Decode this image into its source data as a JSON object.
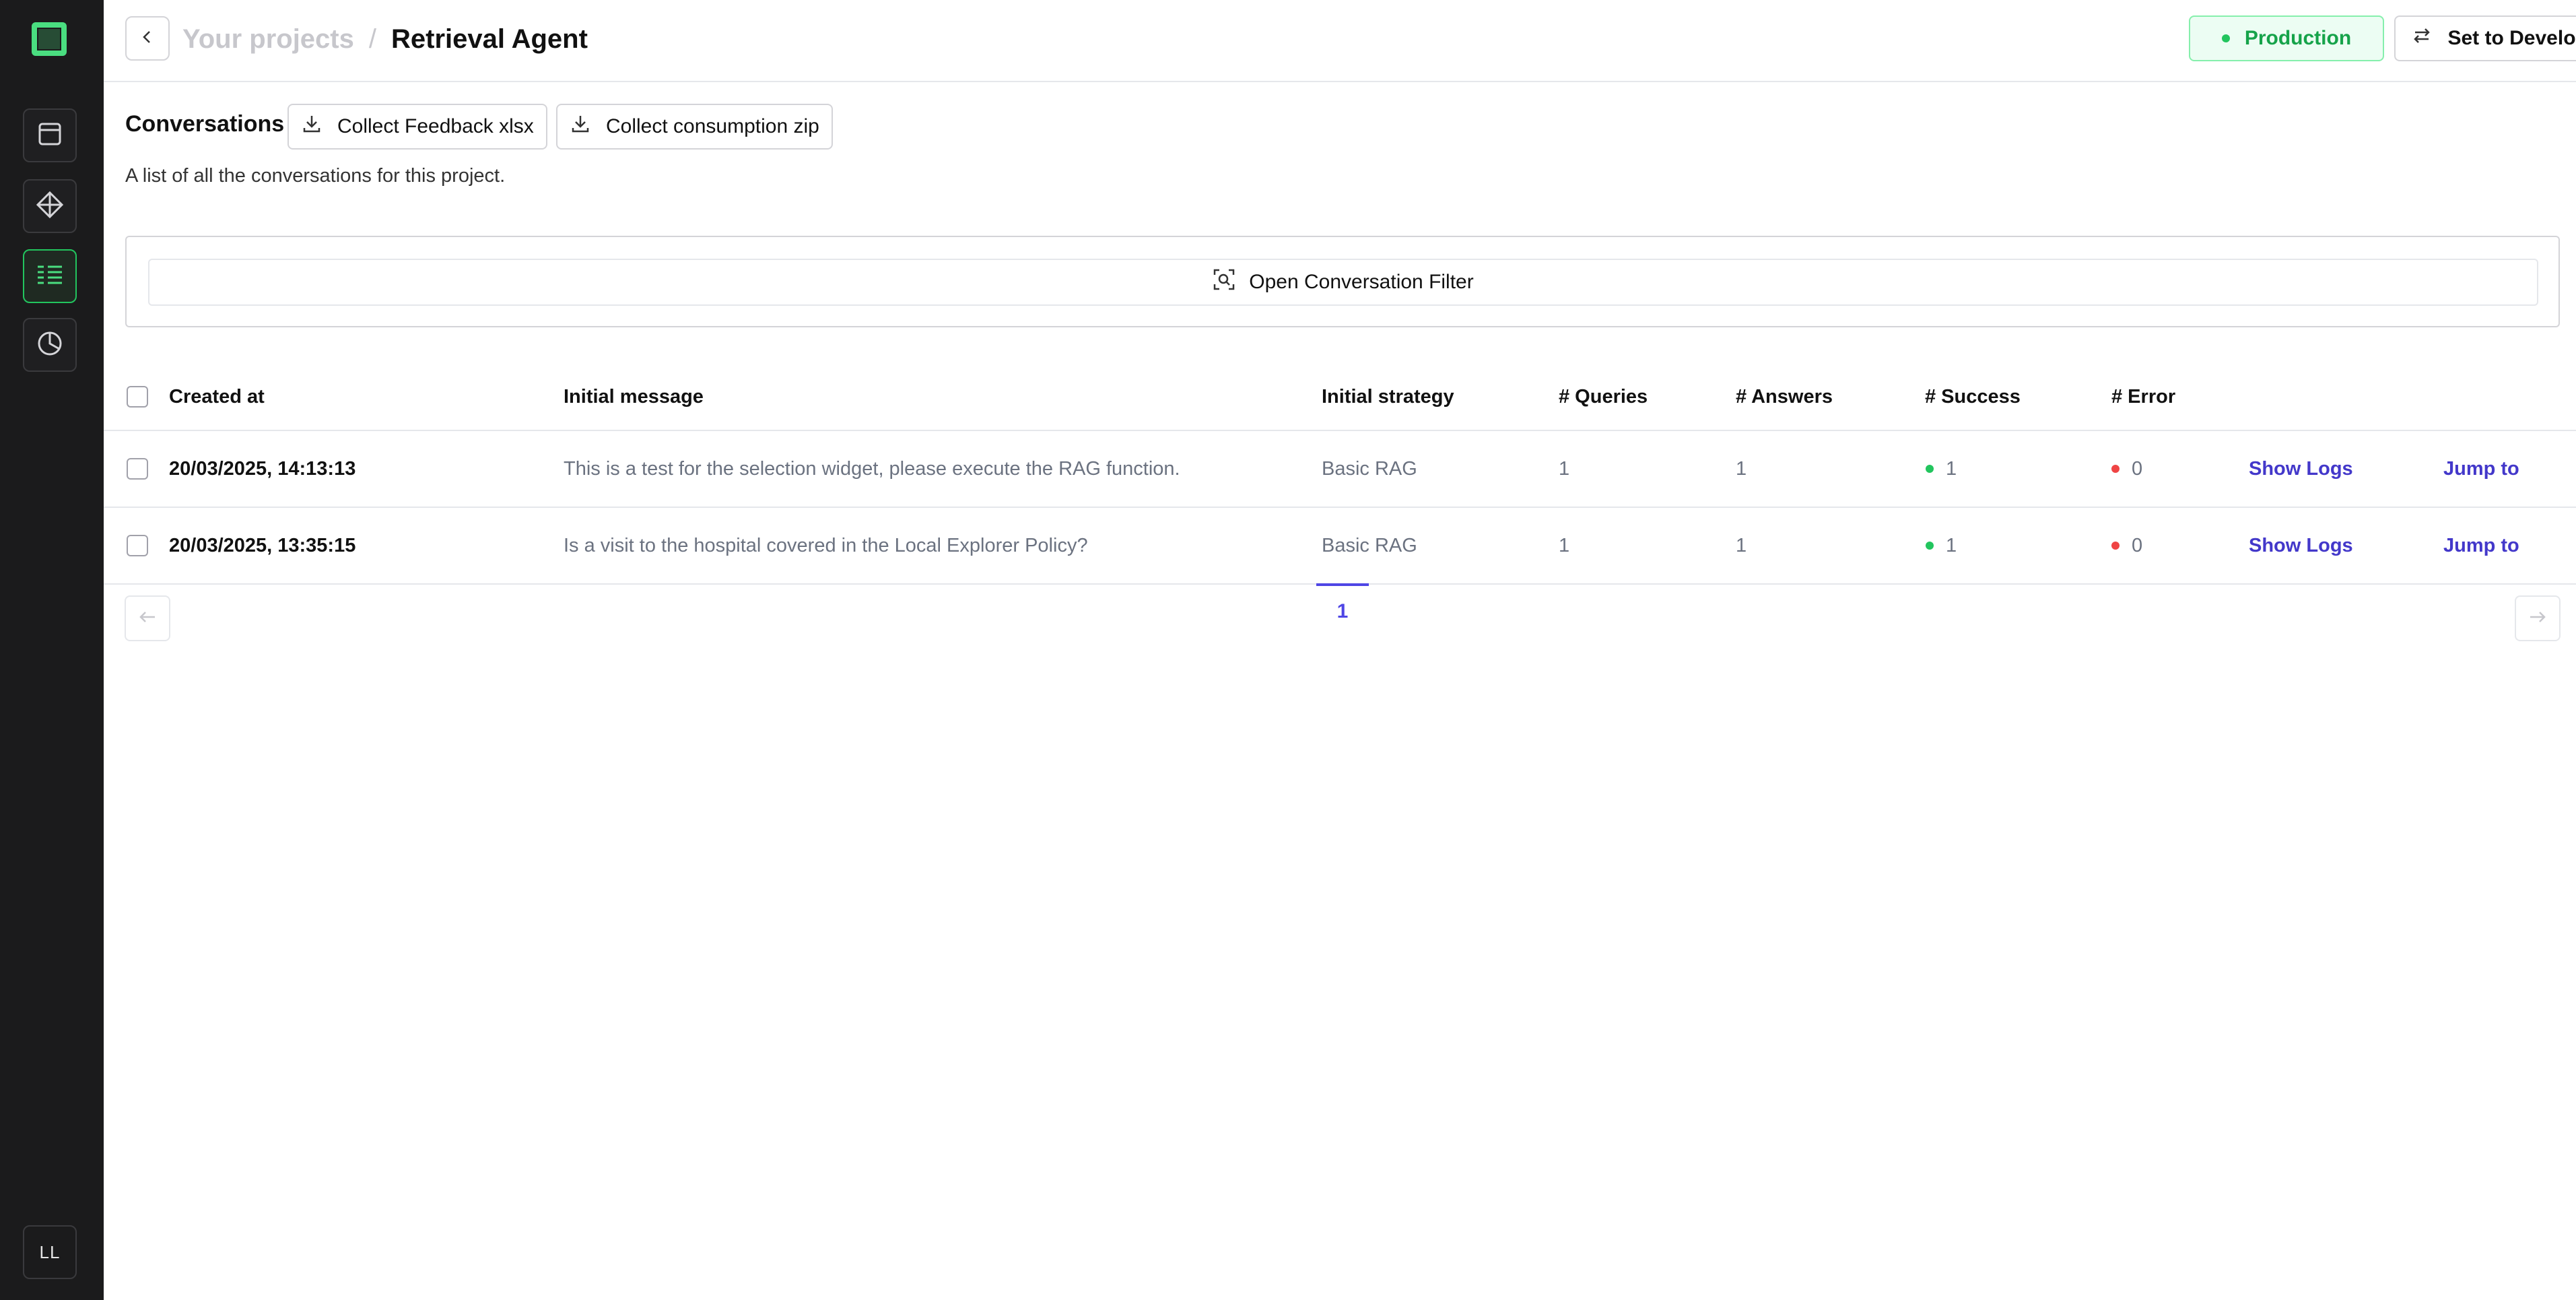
{
  "sidebar": {
    "logo_icon": "app-logo",
    "items": [
      {
        "icon": "window-icon",
        "active": false
      },
      {
        "icon": "diamond-icon",
        "active": false
      },
      {
        "icon": "list-icon",
        "active": true
      },
      {
        "icon": "pie-chart-icon",
        "active": false
      }
    ],
    "avatar_initials": "LL"
  },
  "header": {
    "parent_crumb": "Your projects",
    "separator": "/",
    "current_crumb": "Retrieval Agent",
    "environment_badge": "Production",
    "switch_button": "Set to Development"
  },
  "conversations": {
    "title": "Conversations",
    "collect_feedback": "Collect Feedback xlsx",
    "collect_consumption": "Collect consumption zip",
    "description": "A list of all the conversations for this project.",
    "filter_button": "Open Conversation Filter"
  },
  "table": {
    "columns": {
      "created_at": "Created at",
      "initial_message": "Initial message",
      "initial_strategy": "Initial strategy",
      "queries": "# Queries",
      "answers": "# Answers",
      "success": "# Success",
      "error": "# Error"
    },
    "rows": [
      {
        "created_at": "20/03/2025, 14:13:13",
        "initial_message": "This is a test for the selection widget, please execute the RAG function.",
        "initial_strategy": "Basic RAG",
        "queries": "1",
        "answers": "1",
        "success": "1",
        "error": "0",
        "show_logs": "Show Logs",
        "jump_to": "Jump to"
      },
      {
        "created_at": "20/03/2025, 13:35:15",
        "initial_message": "Is a visit to the hospital covered in the Local Explorer Policy?",
        "initial_strategy": "Basic RAG",
        "queries": "1",
        "answers": "1",
        "success": "1",
        "error": "0",
        "show_logs": "Show Logs",
        "jump_to": "Jump to"
      }
    ]
  },
  "pagination": {
    "current_page": "1"
  },
  "colors": {
    "accent_green": "#22c55e",
    "link_indigo": "#4338ca",
    "error_red": "#ef4444",
    "sidebar_bg": "#1b1b1c"
  }
}
